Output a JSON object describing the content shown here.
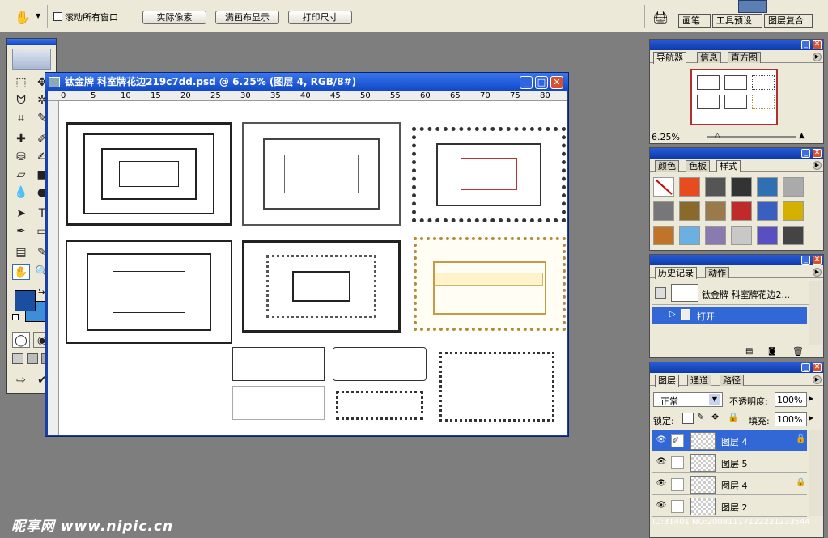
{
  "options_bar": {
    "checkbox_label": "滚动所有窗口",
    "actual_pixels": "实际像素",
    "fit_screen": "满画布显示",
    "print_size": "打印尺寸",
    "palette_tabs": [
      "画笔",
      "工具预设",
      "图层复合"
    ]
  },
  "document": {
    "title": "钛金牌 科室牌花边219c7dd.psd @ 6.25% (图层 4, RGB/8#)",
    "ruler_ticks": [
      "0",
      "5",
      "10",
      "15",
      "20",
      "25",
      "30",
      "35",
      "40",
      "45",
      "50",
      "55",
      "60",
      "65",
      "70",
      "75",
      "80"
    ]
  },
  "navigator": {
    "tabs": [
      "导航器",
      "信息",
      "直方图"
    ],
    "zoom": "6.25%"
  },
  "color_panel": {
    "tabs": [
      "颜色",
      "色板",
      "样式"
    ]
  },
  "history": {
    "tabs": [
      "历史记录",
      "动作"
    ],
    "snapshot_label": "钛金牌 科室牌花边2...",
    "step_label": "打开"
  },
  "layers": {
    "tabs": [
      "图层",
      "通道",
      "路径"
    ],
    "blend_mode": "正常",
    "opacity_label": "不透明度:",
    "opacity_value": "100%",
    "lock_label": "锁定:",
    "fill_label": "填充:",
    "fill_value": "100%",
    "rows": [
      {
        "name": "图层 4"
      },
      {
        "name": "图层 5"
      },
      {
        "name": "图层 4"
      },
      {
        "name": "图层 2"
      }
    ]
  },
  "watermark": {
    "logo": "昵享网 www.nipic.cn",
    "id_text": "ID:31401 NO:20081117122221233544"
  },
  "colors": {
    "foreground": "#1a4fa0",
    "background": "#3a8fd8",
    "title_blue": "#0f46c5",
    "selection": "#3168d5"
  }
}
